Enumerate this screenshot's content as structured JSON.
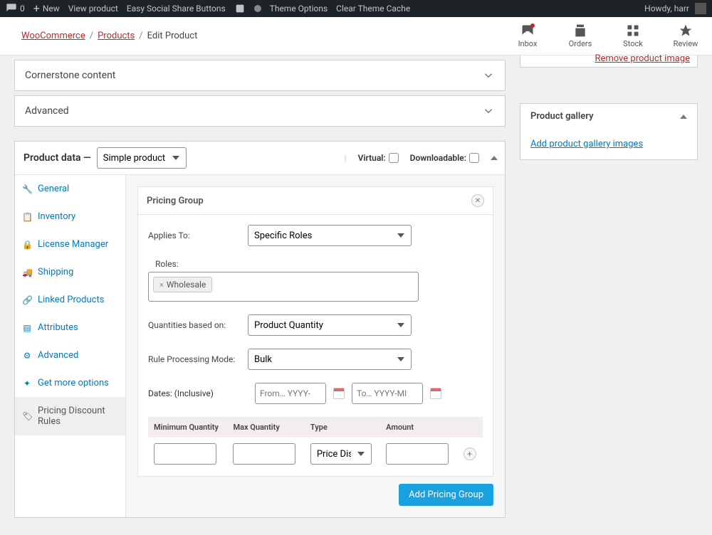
{
  "adminbar": {
    "comments_count": "0",
    "new_label": "New",
    "view_product": "View product",
    "essb": "Easy Social Share Buttons",
    "theme_options": "Theme Options",
    "clear_cache": "Clear Theme Cache",
    "howdy": "Howdy, harr"
  },
  "breadcrumb": {
    "root": "WooCommerce",
    "products": "Products",
    "current": "Edit Product"
  },
  "stats": {
    "inbox": "Inbox",
    "orders": "Orders",
    "stock": "Stock",
    "reviews": "Review"
  },
  "collapsed": {
    "cornerstone": "Cornerstone content",
    "advanced": "Advanced"
  },
  "product_data": {
    "label": "Product data —",
    "type_value": "Simple product",
    "virtual": "Virtual:",
    "downloadable": "Downloadable:"
  },
  "tabs": {
    "general": "General",
    "inventory": "Inventory",
    "license": "License Manager",
    "shipping": "Shipping",
    "linked": "Linked Products",
    "attributes": "Attributes",
    "advanced": "Advanced",
    "getmore": "Get more options",
    "pricing": "Pricing Discount Rules"
  },
  "pricing_group": {
    "title": "Pricing Group",
    "applies_to_label": "Applies To:",
    "applies_to_value": "Specific Roles",
    "roles_label": "Roles:",
    "role_tag": "Wholesale",
    "quantities_label": "Quantities based on:",
    "quantities_value": "Product Quantity",
    "rule_mode_label": "Rule Processing Mode:",
    "rule_mode_value": "Bulk",
    "dates_label": "Dates: (Inclusive)",
    "date_from_placeholder": "From… YYYY-",
    "date_to_placeholder": "To… YYYY-MI",
    "table": {
      "min": "Minimum Quantity",
      "max": "Max Quantity",
      "type": "Type",
      "amount": "Amount",
      "type_value": "Price Disc"
    },
    "add_btn": "Add Pricing Group"
  },
  "sidebar_right": {
    "remove_image": "Remove product image",
    "gallery_title": "Product gallery",
    "add_gallery": "Add product gallery images"
  }
}
